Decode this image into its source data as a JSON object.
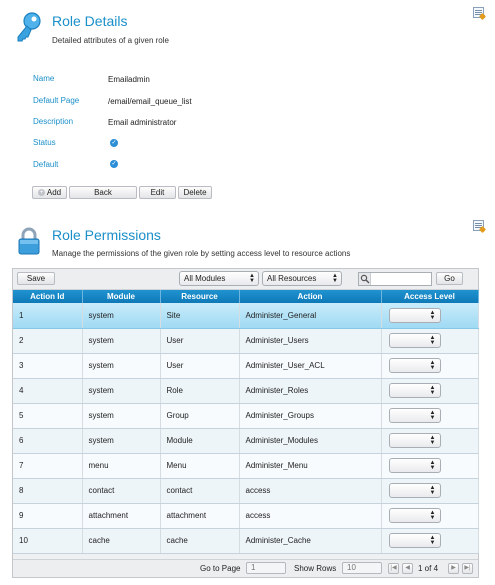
{
  "details": {
    "title": "Role Details",
    "subtitle": "Detailed attributes of a given role",
    "fields": [
      {
        "label": "Name",
        "value": "Emailadmin"
      },
      {
        "label": "Default Page",
        "value": "/email/email_queue_list"
      },
      {
        "label": "Description",
        "value": "Email administrator"
      },
      {
        "label": "Status",
        "value": ""
      },
      {
        "label": "Default",
        "value": ""
      }
    ],
    "buttons": {
      "add": "Add",
      "back": "Back",
      "edit": "Edit",
      "delete": "Delete"
    }
  },
  "permissions": {
    "title": "Role Permissions",
    "subtitle": "Manage the permissions of the given role by setting access level to resource actions",
    "toolbar": {
      "save": "Save",
      "modules_filter": "All Modules",
      "resources_filter": "All Resources",
      "search_value": "",
      "go": "Go"
    },
    "columns": [
      "Action Id",
      "Module",
      "Resource",
      "Action",
      "Access Level"
    ],
    "rows": [
      {
        "id": "1",
        "module": "system",
        "resource": "Site",
        "action": "Administer_General",
        "access": ""
      },
      {
        "id": "2",
        "module": "system",
        "resource": "User",
        "action": "Administer_Users",
        "access": ""
      },
      {
        "id": "3",
        "module": "system",
        "resource": "User",
        "action": "Administer_User_ACL",
        "access": ""
      },
      {
        "id": "4",
        "module": "system",
        "resource": "Role",
        "action": "Administer_Roles",
        "access": ""
      },
      {
        "id": "5",
        "module": "system",
        "resource": "Group",
        "action": "Administer_Groups",
        "access": ""
      },
      {
        "id": "6",
        "module": "system",
        "resource": "Module",
        "action": "Administer_Modules",
        "access": ""
      },
      {
        "id": "7",
        "module": "menu",
        "resource": "Menu",
        "action": "Administer_Menu",
        "access": ""
      },
      {
        "id": "8",
        "module": "contact",
        "resource": "contact",
        "action": "access",
        "access": ""
      },
      {
        "id": "9",
        "module": "attachment",
        "resource": "attachment",
        "action": "access",
        "access": ""
      },
      {
        "id": "10",
        "module": "cache",
        "resource": "cache",
        "action": "Administer_Cache",
        "access": ""
      }
    ],
    "pager": {
      "go_to_page_label": "Go to Page",
      "page_value": "1",
      "show_rows_label": "Show Rows",
      "rows_value": "10",
      "page_info": "1 of 4"
    }
  },
  "colors": {
    "accent": "#1a8fc9",
    "header_bg": "#1283c2",
    "selected_row": "#b6e4f8"
  }
}
